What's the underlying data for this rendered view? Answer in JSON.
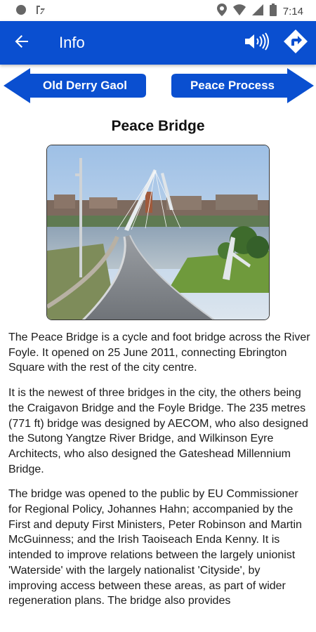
{
  "status": {
    "time": "7:14"
  },
  "appbar": {
    "title": "Info"
  },
  "nav": {
    "prev_label": "Old Derry Gaol",
    "next_label": "Peace Process"
  },
  "content": {
    "title": "Peace Bridge",
    "paragraphs": [
      "The Peace Bridge is a cycle and foot bridge across the River Foyle. It opened on 25 June 2011, connecting Ebrington Square with the rest of the city centre.",
      "It is the newest of three bridges in the city, the others being the Craigavon Bridge and the Foyle Bridge. The 235 metres (771 ft) bridge was designed by AECOM, who also designed the Sutong Yangtze River Bridge, and Wilkinson Eyre Architects, who also designed the Gateshead Millennium Bridge.",
      "The bridge was opened to the public by EU Commissioner for Regional Policy, Johannes Hahn; accompanied by the First and deputy First Ministers, Peter Robinson and Martin McGuinness; and the Irish Taoiseach Enda Kenny. It is intended to improve relations between the largely unionist 'Waterside' with the largely nationalist 'Cityside', by improving access between these areas, as part of wider regeneration plans. The bridge also provides"
    ]
  },
  "colors": {
    "primary": "#0a4fd0",
    "text": "#1b1b1b"
  },
  "icons": [
    "circle-icon",
    "notification-icon",
    "location-icon",
    "wifi-icon",
    "signal-icon",
    "battery-icon",
    "back-arrow-icon",
    "sound-icon",
    "directions-icon"
  ]
}
